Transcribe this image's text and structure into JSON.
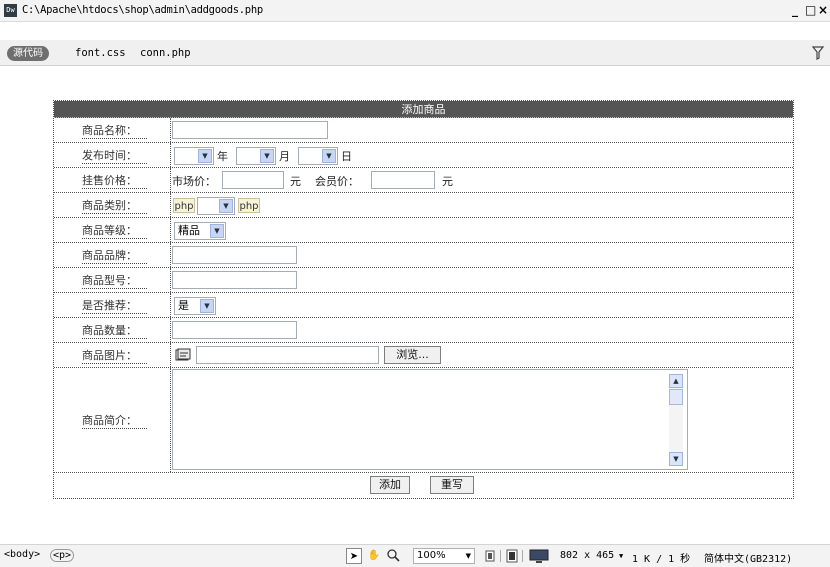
{
  "window": {
    "title_path": "C:\\Apache\\htdocs\\shop\\admin\\addgoods.php",
    "app_icon_text": "Dw",
    "minimize": "_",
    "maximize": "□",
    "close": "×"
  },
  "docbar": {
    "source_button": "源代码",
    "files": [
      "font.css",
      "conn.php"
    ],
    "filter_icon": "filter-icon"
  },
  "form": {
    "title": "添加商品",
    "rows": {
      "name": {
        "label": "商品名称："
      },
      "date": {
        "label": "发布时间：",
        "year": "年",
        "month": "月",
        "day": "日"
      },
      "price": {
        "label": "挂售价格：",
        "market": "市场价：",
        "unit1": "元",
        "member": "会员价：",
        "unit2": "元"
      },
      "category": {
        "label": "商品类别："
      },
      "grade": {
        "label": "商品等级：",
        "selected": "精品"
      },
      "brand": {
        "label": "商品品牌："
      },
      "model": {
        "label": "商品型号："
      },
      "recommend": {
        "label": "是否推荐：",
        "selected": "是"
      },
      "quantity": {
        "label": "商品数量："
      },
      "image": {
        "label": "商品图片：",
        "browse": "浏览..."
      },
      "intro": {
        "label": "商品简介："
      }
    },
    "submit": "添加",
    "reset": "重写"
  },
  "statusbar": {
    "tag_body": "<body>",
    "tag_p": "<p>",
    "zoom": "100%",
    "dimensions": "802 x 465",
    "size_time": "1 K / 1 秒",
    "encoding": "简体中文(GB2312)"
  },
  "colors": {
    "form_header_bg": "#555555",
    "form_header_text": "#ffffff"
  }
}
